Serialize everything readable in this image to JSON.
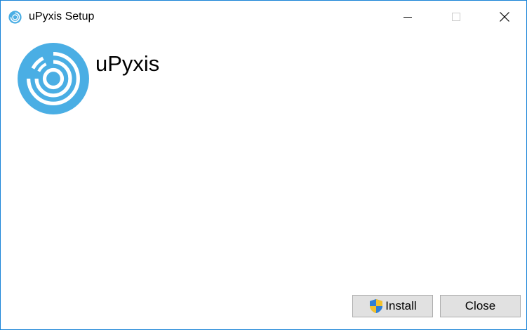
{
  "window": {
    "title": "uPyxis Setup",
    "title_icon": "upyxis-logo-icon"
  },
  "controls": {
    "minimize_icon": "minimize-icon",
    "maximize_icon": "maximize-icon",
    "close_icon": "close-icon"
  },
  "header": {
    "app_name": "uPyxis",
    "logo_icon": "upyxis-logo-icon"
  },
  "buttons": {
    "install_label": "Install",
    "install_icon": "uac-shield-icon",
    "close_label": "Close"
  },
  "colors": {
    "window_border": "#1883d7",
    "logo_blue": "#4aaee4",
    "button_bg": "#e1e1e1",
    "button_border": "#adadad"
  }
}
